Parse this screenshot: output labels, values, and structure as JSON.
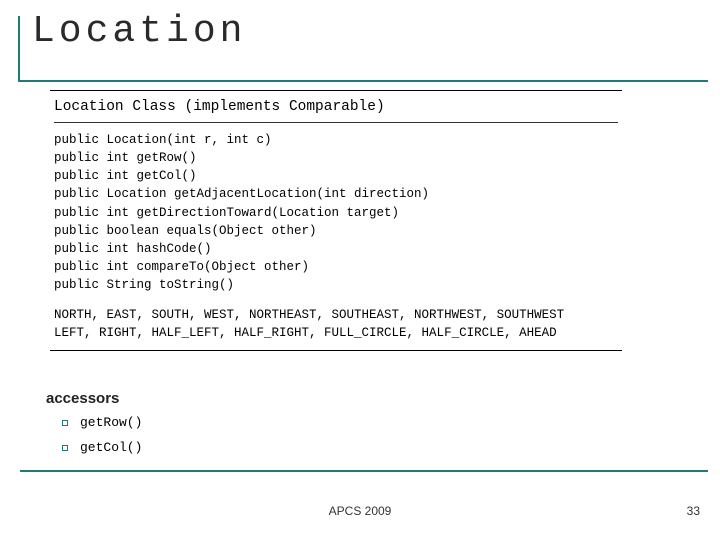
{
  "title": "Location",
  "class_box": {
    "heading": "Location Class (implements Comparable)",
    "methods": "public Location(int r, int c)\npublic int getRow()\npublic int getCol()\npublic Location getAdjacentLocation(int direction)\npublic int getDirectionToward(Location target)\npublic boolean equals(Object other)\npublic int hashCode()\npublic int compareTo(Object other)\npublic String toString()",
    "constants": "NORTH, EAST, SOUTH, WEST, NORTHEAST, SOUTHEAST, NORTHWEST, SOUTHWEST\nLEFT, RIGHT, HALF_LEFT, HALF_RIGHT, FULL_CIRCLE, HALF_CIRCLE, AHEAD"
  },
  "accessors": {
    "heading": "accessors",
    "items": [
      "getRow()",
      "getCol()"
    ]
  },
  "footer": {
    "center": "APCS 2009",
    "page": "33"
  }
}
